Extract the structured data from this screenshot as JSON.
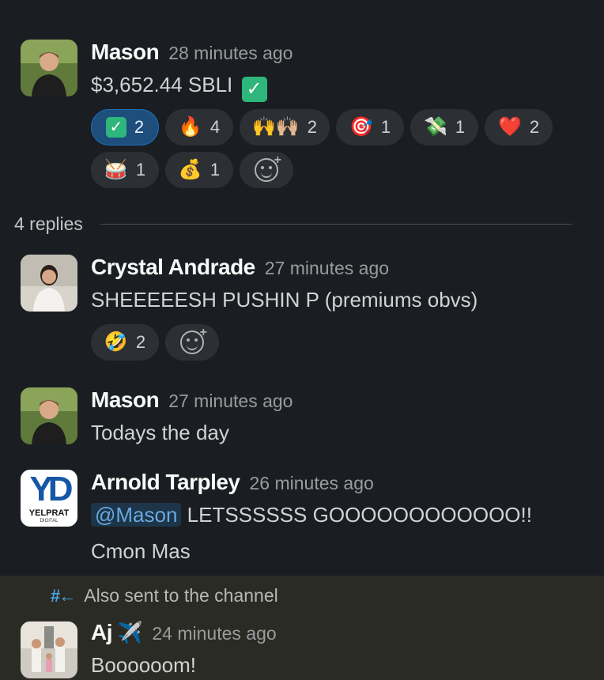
{
  "messages": {
    "m1": {
      "author": "Mason",
      "time": "28 minutes ago",
      "text": "$3,652.44 SBLI",
      "reactions": [
        {
          "emoji": "check",
          "count": "2"
        },
        {
          "emoji": "🔥",
          "count": "4"
        },
        {
          "emoji": "🙌🙌🏼",
          "count": "2"
        },
        {
          "emoji": "🎯",
          "count": "1"
        },
        {
          "emoji": "💸",
          "count": "1"
        },
        {
          "emoji": "❤️",
          "count": "2"
        },
        {
          "emoji": "🥁",
          "count": "1"
        },
        {
          "emoji": "💰",
          "count": "1"
        }
      ]
    },
    "replies_label": "4 replies",
    "m2": {
      "author": "Crystal Andrade",
      "time": "27 minutes ago",
      "text": "SHEEEEESH PUSHIN P (premiums obvs)",
      "reactions": [
        {
          "emoji": "🤣",
          "count": "2"
        }
      ]
    },
    "m3": {
      "author": "Mason",
      "time": "27 minutes ago",
      "text": "Todays the day"
    },
    "m4": {
      "author": "Arnold Tarpley",
      "time": "26 minutes ago",
      "mention": "@Mason",
      "text": " LETSSSSSS GOOOOOOOOOOOO!!",
      "text2": "Cmon Mas",
      "avatar_text": "YD",
      "avatar_sub": "YELPRAT",
      "avatar_sub2": "DIGITAL"
    },
    "also_sent": "Also sent to the channel",
    "m5": {
      "author": "Aj",
      "author_emoji": "✈️",
      "time": "24 minutes ago",
      "text": "Boooooom!"
    }
  },
  "colors": {
    "background": "#1a1d21",
    "active_reaction": "#1d4e7c",
    "mention": "#69a8e0",
    "highlight": "#2b2b25"
  }
}
